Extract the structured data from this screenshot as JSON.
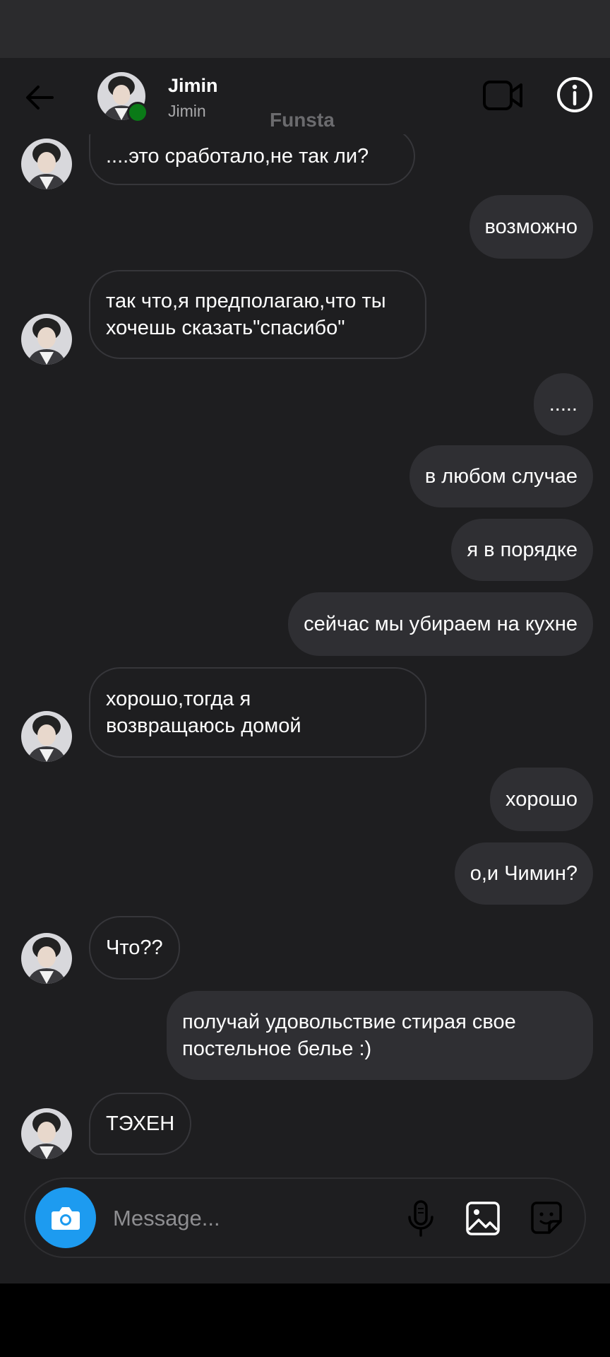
{
  "header": {
    "name": "Jimin",
    "username": "Jimin",
    "watermark": "Funsta"
  },
  "messages": [
    {
      "side": "in",
      "text": "....это сработало,не так ли?"
    },
    {
      "side": "out",
      "text": "возможно"
    },
    {
      "side": "in",
      "text": "так что,я предполагаю,что ты хочешь сказать\"спасибо\""
    },
    {
      "side": "out",
      "text": "....."
    },
    {
      "side": "out",
      "text": "в любом случае"
    },
    {
      "side": "out",
      "text": "я в порядке"
    },
    {
      "side": "out",
      "text": "сейчас мы убираем на кухне"
    },
    {
      "side": "in",
      "text": "хорошо,тогда я возвращаюсь домой"
    },
    {
      "side": "out",
      "text": "хорошо"
    },
    {
      "side": "out",
      "text": "о,и Чимин?"
    },
    {
      "side": "in",
      "text": "Что??"
    },
    {
      "side": "out",
      "text": "получай удовольствие стирая свое постельное белье :)"
    },
    {
      "side": "in",
      "text": "ТЭХЕН"
    }
  ],
  "composer": {
    "placeholder": "Message..."
  },
  "icons": {
    "back": "arrow-left-icon",
    "video": "video-call-icon",
    "info": "info-icon",
    "camera": "camera-icon",
    "mic": "microphone-icon",
    "gallery": "gallery-icon",
    "sticker": "sticker-icon"
  },
  "colors": {
    "background": "#1e1e20",
    "outgoing_bubble": "#2f2f33",
    "incoming_border": "#36363a",
    "camera_button": "#1d9bf0",
    "online_dot": "#0a7a17"
  }
}
